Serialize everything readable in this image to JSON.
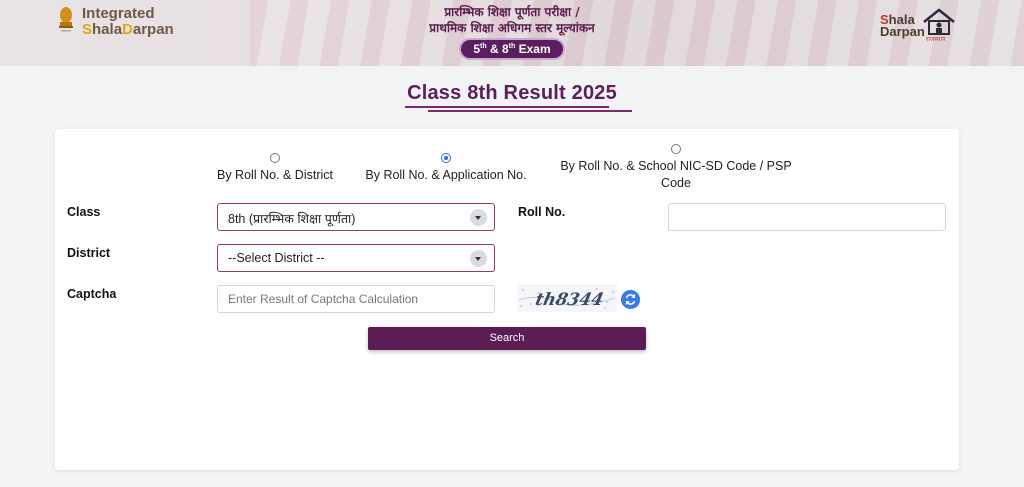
{
  "header": {
    "logo_left_line1": "Integrated",
    "logo_left_line2_a": "S",
    "logo_left_line2_b": "hala",
    "logo_left_line2_c": "D",
    "logo_left_line2_d": "arpan",
    "title_line1": "प्रारम्भिक शिक्षा पूर्णता परीक्षा /",
    "title_line2": "प्राथमिक शिक्षा अधिगम स्तर मूल्यांकन",
    "exam_pill_a": "5",
    "exam_pill_sup_a": "th",
    "exam_pill_mid": " & 8",
    "exam_pill_sup_b": "th",
    "exam_pill_b": " Exam",
    "logo_right_line1_a": "S",
    "logo_right_line1_b": "hala",
    "logo_right_line2": "Darpan",
    "logo_right_sub": "राजस्थान",
    "colors": {
      "brand": "#5b1d60",
      "accent": "#e8a317"
    }
  },
  "page": {
    "title": "Class 8th Result 2025"
  },
  "form": {
    "search_modes": [
      {
        "label": "By Roll No. & District",
        "checked": false
      },
      {
        "label": "By Roll No. & Application No.",
        "checked": true
      },
      {
        "label": "By Roll No. & School NIC-SD Code / PSP Code",
        "checked": false
      }
    ],
    "class_label": "Class",
    "class_value": "8th (प्रारम्भिक शिक्षा पूर्णता)",
    "roll_label": "Roll No.",
    "roll_value": "",
    "district_label": "District",
    "district_value": "--Select District --",
    "captcha_label": "Captcha",
    "captcha_placeholder": "Enter Result of Captcha Calculation",
    "captcha_text": "th8344",
    "search_label": "Search",
    "icons": {
      "dropdown": "chevron-down-icon",
      "refresh": "refresh-icon",
      "emblem": "national-emblem-icon",
      "house": "house-icon"
    }
  }
}
